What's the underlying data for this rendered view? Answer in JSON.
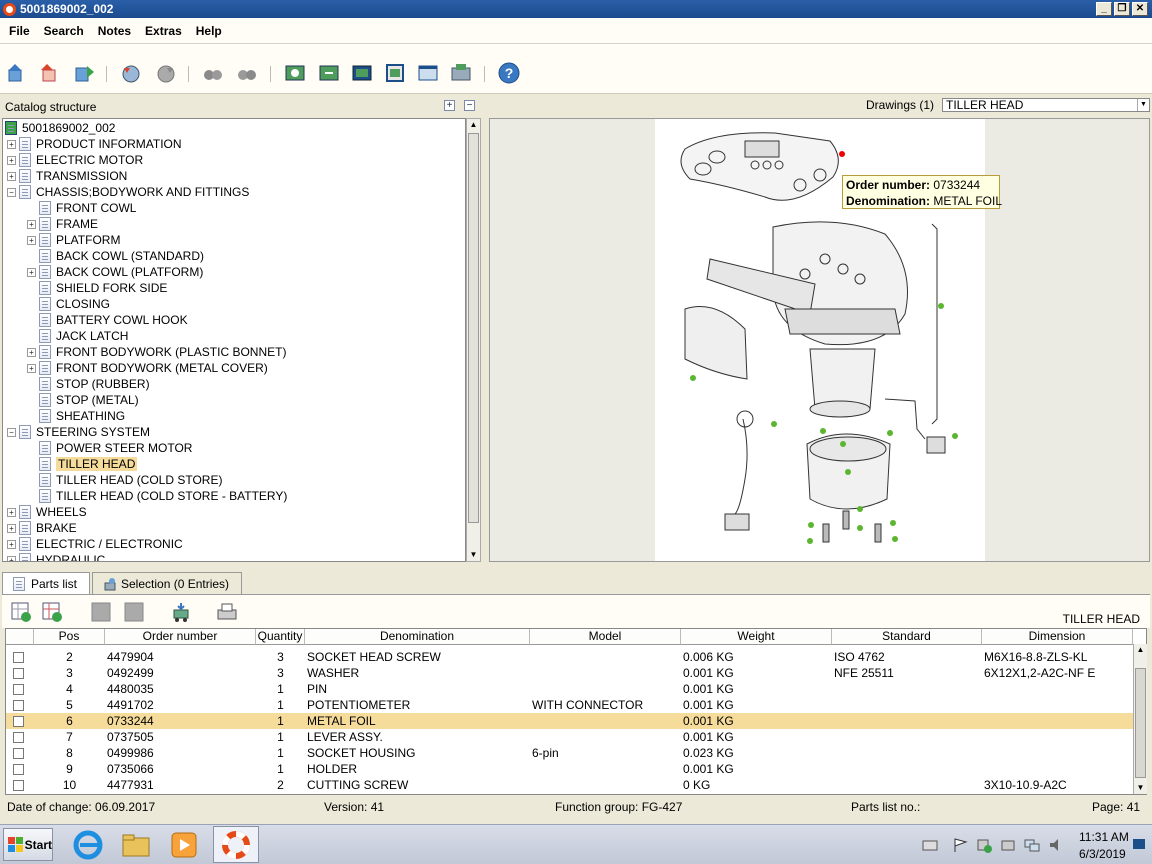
{
  "window": {
    "title": "5001869002_002"
  },
  "menu": [
    "File",
    "Search",
    "Notes",
    "Extras",
    "Help"
  ],
  "left": {
    "label": "Catalog structure",
    "expand": "+",
    "collapse": "−"
  },
  "tree": [
    {
      "label": "5001869002_002",
      "level": 0,
      "kind": "root"
    },
    {
      "label": "PRODUCT INFORMATION",
      "level": 0,
      "kind": "exp"
    },
    {
      "label": "ELECTRIC MOTOR",
      "level": 0,
      "kind": "exp"
    },
    {
      "label": "TRANSMISSION",
      "level": 0,
      "kind": "exp"
    },
    {
      "label": "CHASSIS;BODYWORK AND FITTINGS",
      "level": 0,
      "kind": "open"
    },
    {
      "label": "FRONT COWL",
      "level": 1,
      "kind": "leaf"
    },
    {
      "label": "FRAME",
      "level": 1,
      "kind": "exp"
    },
    {
      "label": "PLATFORM",
      "level": 1,
      "kind": "exp"
    },
    {
      "label": "BACK COWL (STANDARD)",
      "level": 1,
      "kind": "leaf"
    },
    {
      "label": "BACK COWL (PLATFORM)",
      "level": 1,
      "kind": "exp"
    },
    {
      "label": "SHIELD FORK SIDE",
      "level": 1,
      "kind": "leaf"
    },
    {
      "label": "CLOSING",
      "level": 1,
      "kind": "leaf"
    },
    {
      "label": "BATTERY COWL HOOK",
      "level": 1,
      "kind": "leaf"
    },
    {
      "label": "JACK LATCH",
      "level": 1,
      "kind": "leaf"
    },
    {
      "label": "FRONT BODYWORK (PLASTIC BONNET)",
      "level": 1,
      "kind": "exp"
    },
    {
      "label": "FRONT BODYWORK (METAL COVER)",
      "level": 1,
      "kind": "exp"
    },
    {
      "label": "STOP (RUBBER)",
      "level": 1,
      "kind": "leaf"
    },
    {
      "label": "STOP (METAL)",
      "level": 1,
      "kind": "leaf"
    },
    {
      "label": "SHEATHING",
      "level": 1,
      "kind": "leaf"
    },
    {
      "label": "STEERING SYSTEM",
      "level": 0,
      "kind": "open"
    },
    {
      "label": "POWER STEER MOTOR",
      "level": 1,
      "kind": "leaf"
    },
    {
      "label": "TILLER HEAD",
      "level": 1,
      "kind": "leaf",
      "selected": true
    },
    {
      "label": "TILLER HEAD (COLD STORE)",
      "level": 1,
      "kind": "leaf"
    },
    {
      "label": "TILLER HEAD (COLD STORE - BATTERY)",
      "level": 1,
      "kind": "leaf"
    },
    {
      "label": "WHEELS",
      "level": 0,
      "kind": "exp"
    },
    {
      "label": "BRAKE",
      "level": 0,
      "kind": "exp"
    },
    {
      "label": "ELECTRIC / ELECTRONIC",
      "level": 0,
      "kind": "exp"
    },
    {
      "label": "HYDRAULIC",
      "level": 0,
      "kind": "exp"
    }
  ],
  "drawings": {
    "label": "Drawings (1)",
    "selected": "TILLER HEAD"
  },
  "tooltip": {
    "order_label": "Order number:",
    "order_value": "0733244",
    "denom_label": "Denomination:",
    "denom_value": "METAL FOIL"
  },
  "tabs": {
    "parts": "Parts list",
    "selection": "Selection (0 Entries)"
  },
  "parts_title": "TILLER HEAD",
  "columns": [
    "Pos",
    "Order number",
    "Quantity",
    "Denomination",
    "Model",
    "Weight",
    "Standard",
    "Dimension"
  ],
  "rows": [
    {
      "pos": "2",
      "order": "4479904",
      "qty": "3",
      "denom": "SOCKET HEAD SCREW",
      "model": "",
      "weight": "0.006 KG",
      "standard": "ISO 4762",
      "dim": "M6X16-8.8-ZLS-KL"
    },
    {
      "pos": "3",
      "order": "0492499",
      "qty": "3",
      "denom": "WASHER",
      "model": "",
      "weight": "0.001 KG",
      "standard": "NFE 25511",
      "dim": "6X12X1,2-A2C-NF E"
    },
    {
      "pos": "4",
      "order": "4480035",
      "qty": "1",
      "denom": "PIN",
      "model": "",
      "weight": "0.001 KG",
      "standard": "",
      "dim": ""
    },
    {
      "pos": "5",
      "order": "4491702",
      "qty": "1",
      "denom": "POTENTIOMETER",
      "model": "WITH CONNECTOR",
      "weight": "0.001 KG",
      "standard": "",
      "dim": ""
    },
    {
      "pos": "6",
      "order": "0733244",
      "qty": "1",
      "denom": "METAL FOIL",
      "model": "",
      "weight": "0.001 KG",
      "standard": "",
      "dim": "",
      "selected": true
    },
    {
      "pos": "7",
      "order": "0737505",
      "qty": "1",
      "denom": "LEVER ASSY.",
      "model": "",
      "weight": "0.001 KG",
      "standard": "",
      "dim": ""
    },
    {
      "pos": "8",
      "order": "0499986",
      "qty": "1",
      "denom": "SOCKET HOUSING",
      "model": "6-pin",
      "weight": "0.023 KG",
      "standard": "",
      "dim": ""
    },
    {
      "pos": "9",
      "order": "0735066",
      "qty": "1",
      "denom": "HOLDER",
      "model": "",
      "weight": "0.001 KG",
      "standard": "",
      "dim": ""
    },
    {
      "pos": "10",
      "order": "4477931",
      "qty": "2",
      "denom": "CUTTING SCREW",
      "model": "",
      "weight": "0 KG",
      "standard": "",
      "dim": "3X10-10.9-A2C"
    }
  ],
  "status": {
    "date": "Date of change: 06.09.2017",
    "version": "Version: 41",
    "fgroup": "Function group: FG-427",
    "partslist": "Parts list no.:",
    "page": "Page: 41"
  },
  "taskbar": {
    "start": "Start",
    "time": "11:31 AM",
    "date": "6/3/2019"
  }
}
